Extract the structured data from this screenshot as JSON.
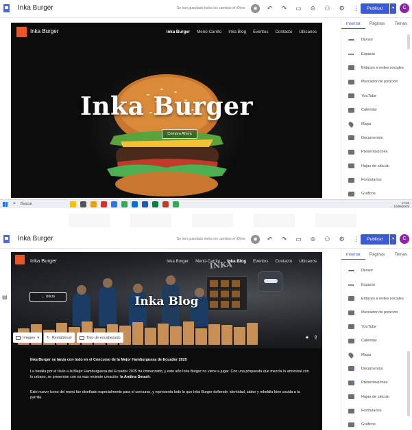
{
  "editor": {
    "site_name": "Inka Burger",
    "saved_note": "Se han guardado todos los cambios en Drive",
    "publish_label": "Publicar",
    "avatar_letter": "C",
    "toolbar_icons": [
      "preview-icon",
      "undo-icon",
      "redo-icon",
      "device-icon",
      "link-icon",
      "add-user-icon",
      "settings-icon",
      "more-icon"
    ]
  },
  "site": {
    "title": "Inka Burger",
    "nav": [
      "Inka Burger",
      "Menú-Carrito",
      "Inka Blog",
      "Eventos",
      "Contacto",
      "Ubicanos"
    ]
  },
  "hero_top": {
    "title": "Inka Burger",
    "button": "Compra Ahora"
  },
  "panel": {
    "tabs": [
      "Insertar",
      "Páginas",
      "Temas"
    ],
    "items": [
      "Divisor",
      "Espacio",
      "Enlaces a redes sociales",
      "Marcador de posición",
      "YouTube",
      "Calendar",
      "Mapa",
      "Documentos",
      "Presentaciones",
      "Hojas de cálculo",
      "Formularios",
      "Gráficos"
    ]
  },
  "taskbar": {
    "search": "Buscar",
    "time": "17:46",
    "date": "10/09/2025"
  },
  "blog": {
    "wall_sign": "INKA",
    "title": "Inka Blog",
    "back_button": "← Inicio",
    "img_toolbar": [
      "Imagen",
      "Restablecer",
      "Tipo de encabezado"
    ],
    "article_heading": "Inka Burger se lanza con todo en el Concurso de la Mejor Hamburguesa de Ecuador 2025",
    "para1_pre": "La batalla por el título a la Mejor Hamburguesa del Ecuador 2025 ha comenzado, y este año Inka Burger no viene a jugar. Con una propuesta que mezcla lo ancestral con lo urbano, se presentan con su más reciente creación: ",
    "para1_bold": "la Andina Smash",
    "para1_post": ".",
    "para2": "Este nuevo ícono del menú fue diseñado especialmente para el concurso, y representa todo lo que Inka Burger defiende: identidad, sabor y rebeldía bien cocida a la parrilla."
  }
}
